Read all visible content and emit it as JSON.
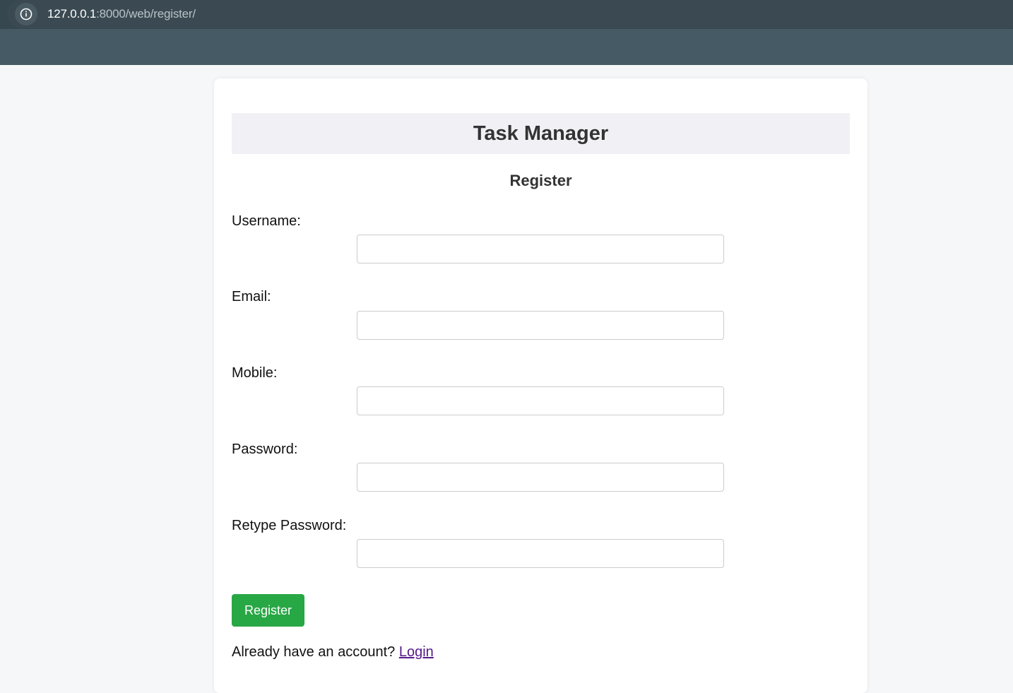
{
  "browser": {
    "url_host": "127.0.0.1",
    "url_rest": ":8000/web/register/"
  },
  "page": {
    "title": "Task Manager",
    "subtitle": "Register"
  },
  "form": {
    "username_label": "Username:",
    "email_label": "Email:",
    "mobile_label": "Mobile:",
    "password_label": "Password:",
    "retype_password_label": "Retype Password:",
    "username_value": "",
    "email_value": "",
    "mobile_value": "",
    "password_value": "",
    "retype_password_value": "",
    "submit_label": "Register"
  },
  "footer": {
    "prompt": "Already have an account? ",
    "login_link": "Login"
  },
  "colors": {
    "accent_button": "#28a745",
    "visited_link": "#551a8b",
    "browser_toolbar": "#455a64"
  },
  "icons": {
    "site_info": "info-icon"
  }
}
